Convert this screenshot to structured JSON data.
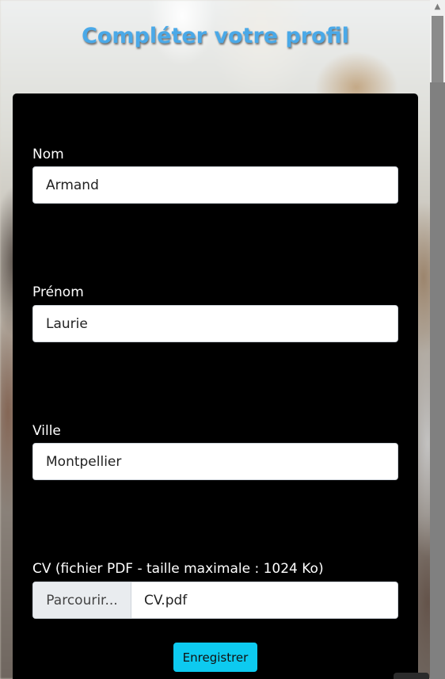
{
  "page": {
    "title": "Compléter votre profil"
  },
  "form": {
    "fields": [
      {
        "label": "Nom",
        "value": "Armand"
      },
      {
        "label": "Prénom",
        "value": "Laurie"
      },
      {
        "label": "Ville",
        "value": "Montpellier"
      }
    ],
    "cv": {
      "label": "CV (fichier PDF - taille maximale : 1024 Ko)",
      "browse_label": "Parcourir...",
      "file_name": "CV.pdf"
    },
    "submit_label": "Enregistrer"
  },
  "icons": {
    "scroll_up": "chevron-up-icon"
  },
  "colors": {
    "title": "#4aa9e8",
    "card_background": "#000000",
    "submit_button": "#0dcaf0"
  }
}
